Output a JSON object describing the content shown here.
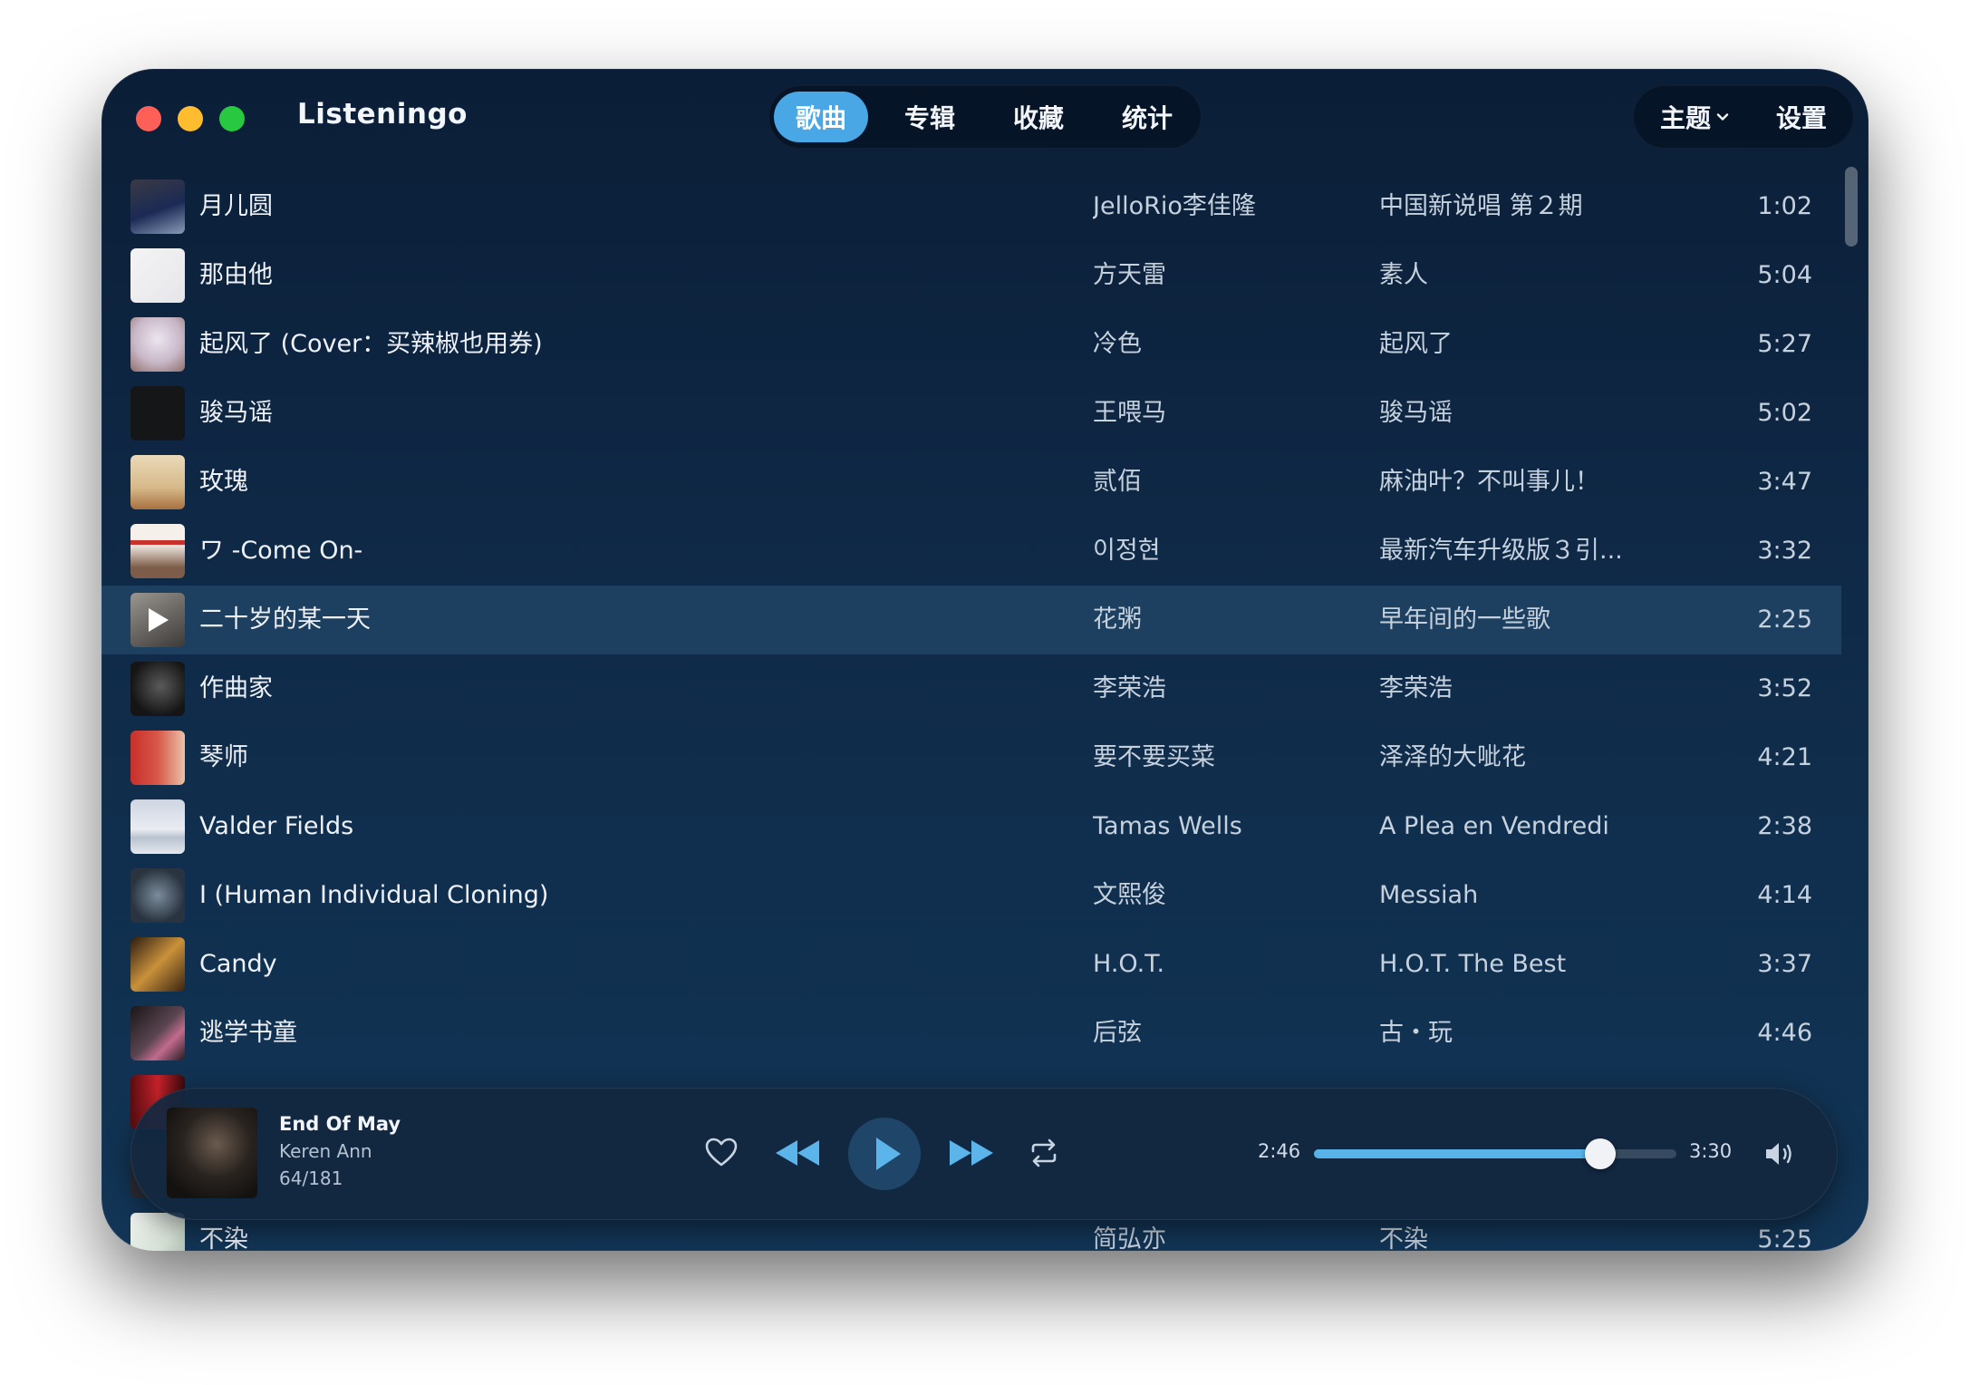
{
  "app": {
    "title": "Listeningo"
  },
  "tabs": [
    {
      "label": "歌曲",
      "active": true
    },
    {
      "label": "专辑",
      "active": false
    },
    {
      "label": "收藏",
      "active": false
    },
    {
      "label": "统计",
      "active": false
    }
  ],
  "header": {
    "theme_label": "主题",
    "settings_label": "设置"
  },
  "colors": {
    "accent": "#48a7e4",
    "background": "#0f2a48",
    "progress_fill": "#58b3e8",
    "close": "#fe5f57",
    "minimize": "#febc2e",
    "maximize": "#28c840"
  },
  "songs": [
    {
      "title": "月儿圆",
      "artist": "JelloRio李佳隆",
      "album": "中国新说唱 第２期",
      "duration": "1:02"
    },
    {
      "title": "那由他",
      "artist": "方天雷",
      "album": "素人",
      "duration": "5:04"
    },
    {
      "title": "起风了 (Cover：买辣椒也用券)",
      "artist": "冷色",
      "album": "起风了",
      "duration": "5:27"
    },
    {
      "title": "骏马谣",
      "artist": "王喂马",
      "album": "骏马谣",
      "duration": "5:02"
    },
    {
      "title": "玫瑰",
      "artist": "贰佰",
      "album": "麻油叶？不叫事儿！",
      "duration": "3:47"
    },
    {
      "title": "ワ -Come On-",
      "artist": "이정현",
      "album": "最新汽车升级版３引...",
      "duration": "3:32"
    },
    {
      "title": "二十岁的某一天",
      "artist": "花粥",
      "album": "早年间的一些歌",
      "duration": "2:25",
      "selected": true
    },
    {
      "title": "作曲家",
      "artist": "李荣浩",
      "album": "李荣浩",
      "duration": "3:52"
    },
    {
      "title": "琴师",
      "artist": "要不要买菜",
      "album": "泽泽的大呲花",
      "duration": "4:21"
    },
    {
      "title": "Valder Fields",
      "artist": "Tamas Wells",
      "album": "A Plea en Vendredi",
      "duration": "2:38"
    },
    {
      "title": "I (Human Individual Cloning)",
      "artist": "文熙俊",
      "album": "Messiah",
      "duration": "4:14"
    },
    {
      "title": "Candy",
      "artist": "H.O.T.",
      "album": "H.O.T. The Best",
      "duration": "3:37"
    },
    {
      "title": "逃学书童",
      "artist": "后弦",
      "album": "古・玩",
      "duration": "4:46"
    },
    {
      "title": "",
      "artist": "",
      "album": "",
      "duration": ""
    },
    {
      "title": "",
      "artist": "",
      "album": "",
      "duration": ""
    },
    {
      "title": "不染",
      "artist": "简弘亦",
      "album": "不染",
      "duration": "5:25"
    }
  ],
  "player": {
    "title": "End Of May",
    "artist": "Keren Ann",
    "index": "64/181",
    "elapsed": "2:46",
    "duration": "3:30",
    "progress": 0.79
  },
  "icons": {
    "heart": "heart-icon",
    "prev": "rewind-icon",
    "play": "play-icon",
    "next": "fast-forward-icon",
    "repeat": "repeat-icon",
    "volume": "volume-icon"
  }
}
